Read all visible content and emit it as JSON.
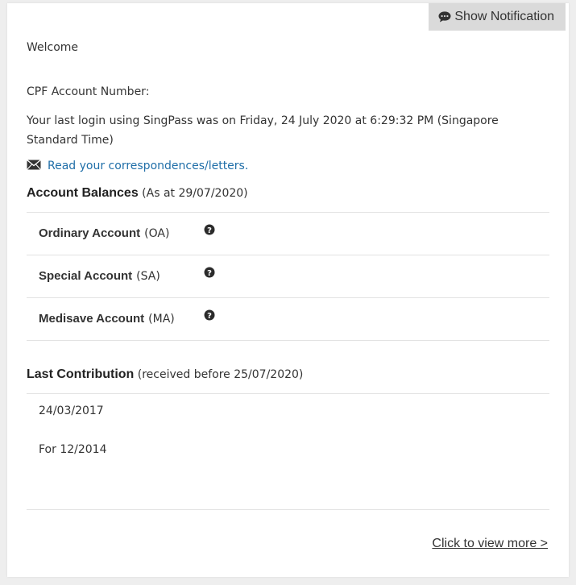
{
  "notification_button": {
    "label": "Show Notification",
    "icon": "chat-bubble-icon"
  },
  "welcome": "Welcome",
  "account_number_label": "CPF Account Number:",
  "last_login": "Your last login using SingPass was on Friday, 24 July 2020 at 6:29:32 PM (Singapore Standard Time)",
  "letters_link": {
    "label": "Read your correspondences/letters.",
    "icon": "envelope-icon"
  },
  "balances": {
    "title": "Account Balances",
    "subtitle": "(As at 29/07/2020)",
    "accounts": [
      {
        "name": "Ordinary Account",
        "abbr": "(OA)",
        "icon": "question-circle-icon"
      },
      {
        "name": "Special Account",
        "abbr": "(SA)",
        "icon": "question-circle-icon"
      },
      {
        "name": "Medisave Account",
        "abbr": "(MA)",
        "icon": "question-circle-icon"
      }
    ]
  },
  "contribution": {
    "title": "Last Contribution",
    "subtitle": "(received before 25/07/2020)",
    "date": "24/03/2017",
    "period": "For 12/2014"
  },
  "view_more": "Click to view more >",
  "colors": {
    "link": "#1f6ea8",
    "button_bg": "#dadada",
    "page_bg": "#eeeeee"
  }
}
